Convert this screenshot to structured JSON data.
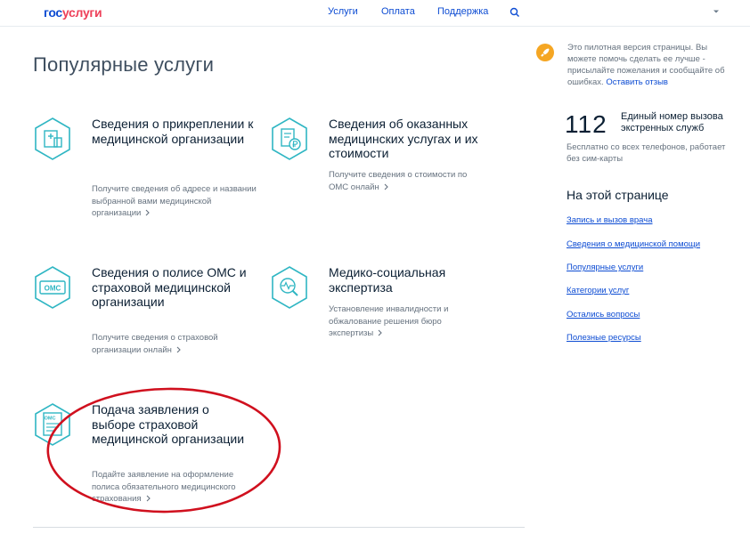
{
  "header": {
    "logo_part1": "гос",
    "logo_part2": "услуги",
    "nav": [
      "Услуги",
      "Оплата",
      "Поддержка"
    ]
  },
  "main": {
    "title": "Популярные услуги",
    "cards": [
      {
        "title": "Сведения о прикреплении к медицинской организации",
        "desc": "Получите сведения об адресе и названии выбранной вами медицинской организации",
        "icon": "building-icon"
      },
      {
        "title": "Сведения об оказанных медицинских услугах и их стоимости",
        "desc": "Получите сведения о стоимости по ОМС онлайн",
        "icon": "ruble-document-icon"
      },
      {
        "title": "Сведения о полисе ОМС и страховой медицинской организации",
        "desc": "Получите сведения о страховой организации онлайн",
        "icon": "oms-card-icon",
        "icon_text": "ОМС"
      },
      {
        "title": "Медико-социальная экспертиза",
        "desc": "Установление инвалидности и обжалование решения бюро экспертизы",
        "icon": "magnifier-pulse-icon"
      },
      {
        "title": "Подача заявления о выборе страховой медицинской организации",
        "desc": "Подайте заявление на оформление полиса обязательного медицинского страхования",
        "icon": "oms-document-icon",
        "icon_text": "ОМС"
      }
    ]
  },
  "sidebar": {
    "pilot_text": "Это пилотная версия страницы. Вы можете помочь сделать ее лучше - присылайте пожелания и сообщайте об ошибках.",
    "pilot_link": "Оставить отзыв",
    "emergency_number": "112",
    "emergency_label": "Единый номер вызова экстренных служб",
    "emergency_note": "Бесплатно со всех телефонов, работает без сим-карты",
    "toc_title": "На этой странице",
    "toc": [
      "Запись и вызов врача",
      "Сведения о медицинской помощи",
      "Популярные услуги",
      "Категории услуг",
      "Остались вопросы",
      "Полезные ресурсы"
    ]
  },
  "colors": {
    "brand_blue": "#0d4cd3",
    "brand_red": "#ee3f58",
    "icon_teal": "#2fb6c3",
    "annotation_red": "#d0101e"
  }
}
